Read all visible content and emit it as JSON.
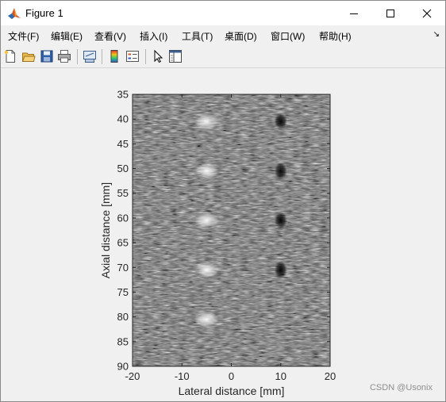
{
  "window": {
    "title": "Figure 1"
  },
  "menu": [
    {
      "label": "文件(F)"
    },
    {
      "label": "编辑(E)"
    },
    {
      "label": "查看(V)"
    },
    {
      "label": "插入(I)"
    },
    {
      "label": "工具(T)"
    },
    {
      "label": "桌面(D)"
    },
    {
      "label": "窗口(W)"
    },
    {
      "label": "帮助(H)"
    }
  ],
  "toolbar": [
    {
      "icon": "new-figure-icon"
    },
    {
      "icon": "open-file-icon"
    },
    {
      "icon": "save-icon"
    },
    {
      "icon": "print-icon"
    },
    {
      "icon": "link-plot-icon"
    },
    {
      "icon": "insert-colorbar-icon"
    },
    {
      "icon": "insert-legend-icon"
    },
    {
      "icon": "edit-plot-pointer-icon"
    },
    {
      "icon": "property-editor-icon"
    }
  ],
  "chart_data": {
    "type": "heatmap",
    "colormap": "gray",
    "xlabel": "Lateral distance [mm]",
    "ylabel": "Axial distance [mm]",
    "xlim": [
      -20,
      20
    ],
    "ylim": [
      35,
      90
    ],
    "y_reversed": true,
    "xticks": [
      -20,
      -10,
      0,
      10,
      20
    ],
    "yticks": [
      35,
      40,
      45,
      50,
      55,
      60,
      65,
      70,
      75,
      80,
      85,
      90
    ],
    "bright_targets": [
      {
        "x": -5,
        "y": 40.5
      },
      {
        "x": -5,
        "y": 50.5
      },
      {
        "x": -5,
        "y": 60.5
      },
      {
        "x": -5,
        "y": 70.5
      },
      {
        "x": -5,
        "y": 80.5
      }
    ],
    "dark_targets": [
      {
        "x": 10,
        "y": 40.5
      },
      {
        "x": 10,
        "y": 50.5
      },
      {
        "x": 10,
        "y": 60.5
      },
      {
        "x": 10,
        "y": 70.5
      }
    ]
  },
  "watermark": "CSDN @Usonix"
}
